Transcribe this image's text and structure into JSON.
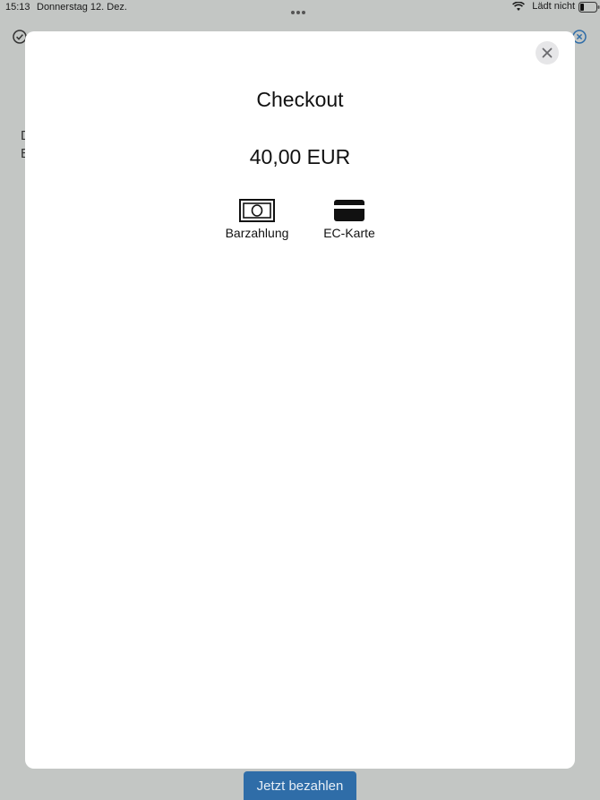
{
  "status_bar": {
    "time": "15:13",
    "date": "Donnerstag 12. Dez.",
    "charging": "Lädt nicht"
  },
  "background": {
    "text_line_1": "D",
    "text_line_2": "E",
    "pay_button_label": "Jetzt bezahlen",
    "accent_color": "#2f6da8"
  },
  "modal": {
    "title": "Checkout",
    "amount": "40,00 EUR",
    "payment_options": [
      {
        "label": "Barzahlung",
        "icon": "cash-icon"
      },
      {
        "label": "EC-Karte",
        "icon": "card-icon"
      }
    ],
    "close_icon": "close-icon"
  }
}
